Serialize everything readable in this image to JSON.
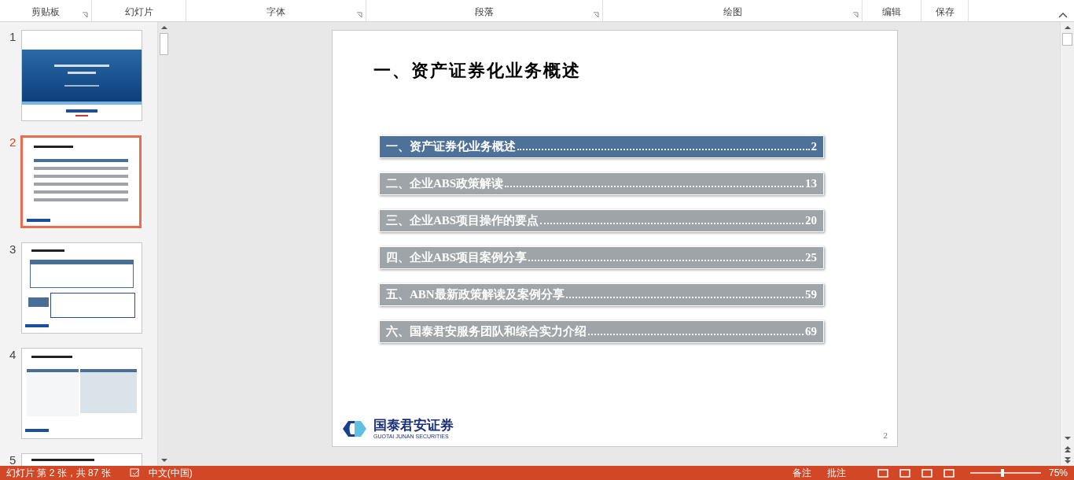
{
  "ribbon": {
    "groups": [
      {
        "label": "剪贴板",
        "launcher": true
      },
      {
        "label": "幻灯片",
        "launcher": false
      },
      {
        "label": "字体",
        "launcher": true
      },
      {
        "label": "段落",
        "launcher": true
      },
      {
        "label": "绘图",
        "launcher": true
      },
      {
        "label": "编辑",
        "launcher": false
      },
      {
        "label": "保存",
        "launcher": false
      }
    ]
  },
  "thumbnails": [
    {
      "number": "1",
      "selected": false,
      "kind": "cover"
    },
    {
      "number": "2",
      "selected": true,
      "kind": "toc"
    },
    {
      "number": "3",
      "selected": false,
      "kind": "text"
    },
    {
      "number": "4",
      "selected": false,
      "kind": "table"
    },
    {
      "number": "5",
      "selected": false,
      "kind": "partial"
    }
  ],
  "slide": {
    "title": "一、资产证券化业务概述",
    "toc": [
      {
        "label": "一、资产证券化业务概述",
        "page": "2",
        "selected": true
      },
      {
        "label": "二、企业ABS政策解读",
        "page": "13",
        "selected": false
      },
      {
        "label": "三、企业ABS项目操作的要点",
        "page": "20",
        "selected": false
      },
      {
        "label": "四、企业ABS项目案例分享",
        "page": "25",
        "selected": false
      },
      {
        "label": "五、ABN最新政策解读及案例分享",
        "page": "59",
        "selected": false
      },
      {
        "label": "六、国泰君安服务团队和综合实力介绍",
        "page": "69",
        "selected": false
      }
    ],
    "logo": {
      "name": "国泰君安证券",
      "subtitle": "GUOTAI JUNAN SECURITIES"
    },
    "page_number": "2"
  },
  "status_bar": {
    "slide_info": "幻灯片 第 2 张，共 87 张",
    "language": "中文(中国)",
    "notes": "备注",
    "comments": "批注",
    "zoom": "75%",
    "zoom_slider": {
      "level": 0.45
    }
  }
}
